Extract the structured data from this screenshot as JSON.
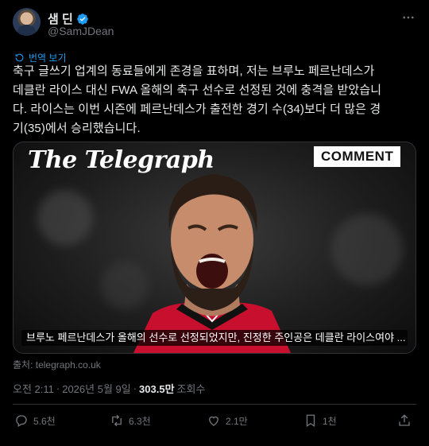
{
  "author": {
    "display_name": "샘 딘",
    "handle": "@SamJDean",
    "verified": true
  },
  "translate_label": "번역 보기",
  "tweet_lines": [
    "축구 글쓰기 업계의 동료들에게 존경을 표하며, 저는 브루노 페르난데스가",
    "데클란 라이스 대신 FWA 올해의 축구 선수로 선정된 것에 충격을 받았습니",
    "다. 라이스는 이번 시즌에 페르난데스가 출전한 경기 수(34)보다 더 많은 경",
    "기(35)에서 승리했습니다."
  ],
  "media": {
    "brand": "The Telegraph",
    "badge": "COMMENT",
    "caption": "브루노 페르난데스가 올해의 선수로 선정되었지만, 진정한 주인공은 데클란 라이스여야 ..."
  },
  "source": "출처: telegraph.co.uk",
  "meta": {
    "time": "오전 2:11",
    "date": "2026년 5월 9일",
    "views": "303.5만",
    "views_label": "조회수",
    "separator": "·"
  },
  "actions": {
    "reply": "5.6천",
    "retweet": "6.3천",
    "like": "2.1만",
    "bookmark": "1천"
  },
  "colors": {
    "background": "#000000",
    "text": "#e7e9ea",
    "muted": "#71767b",
    "accent": "#1d9bf0",
    "border": "#2f3336"
  }
}
